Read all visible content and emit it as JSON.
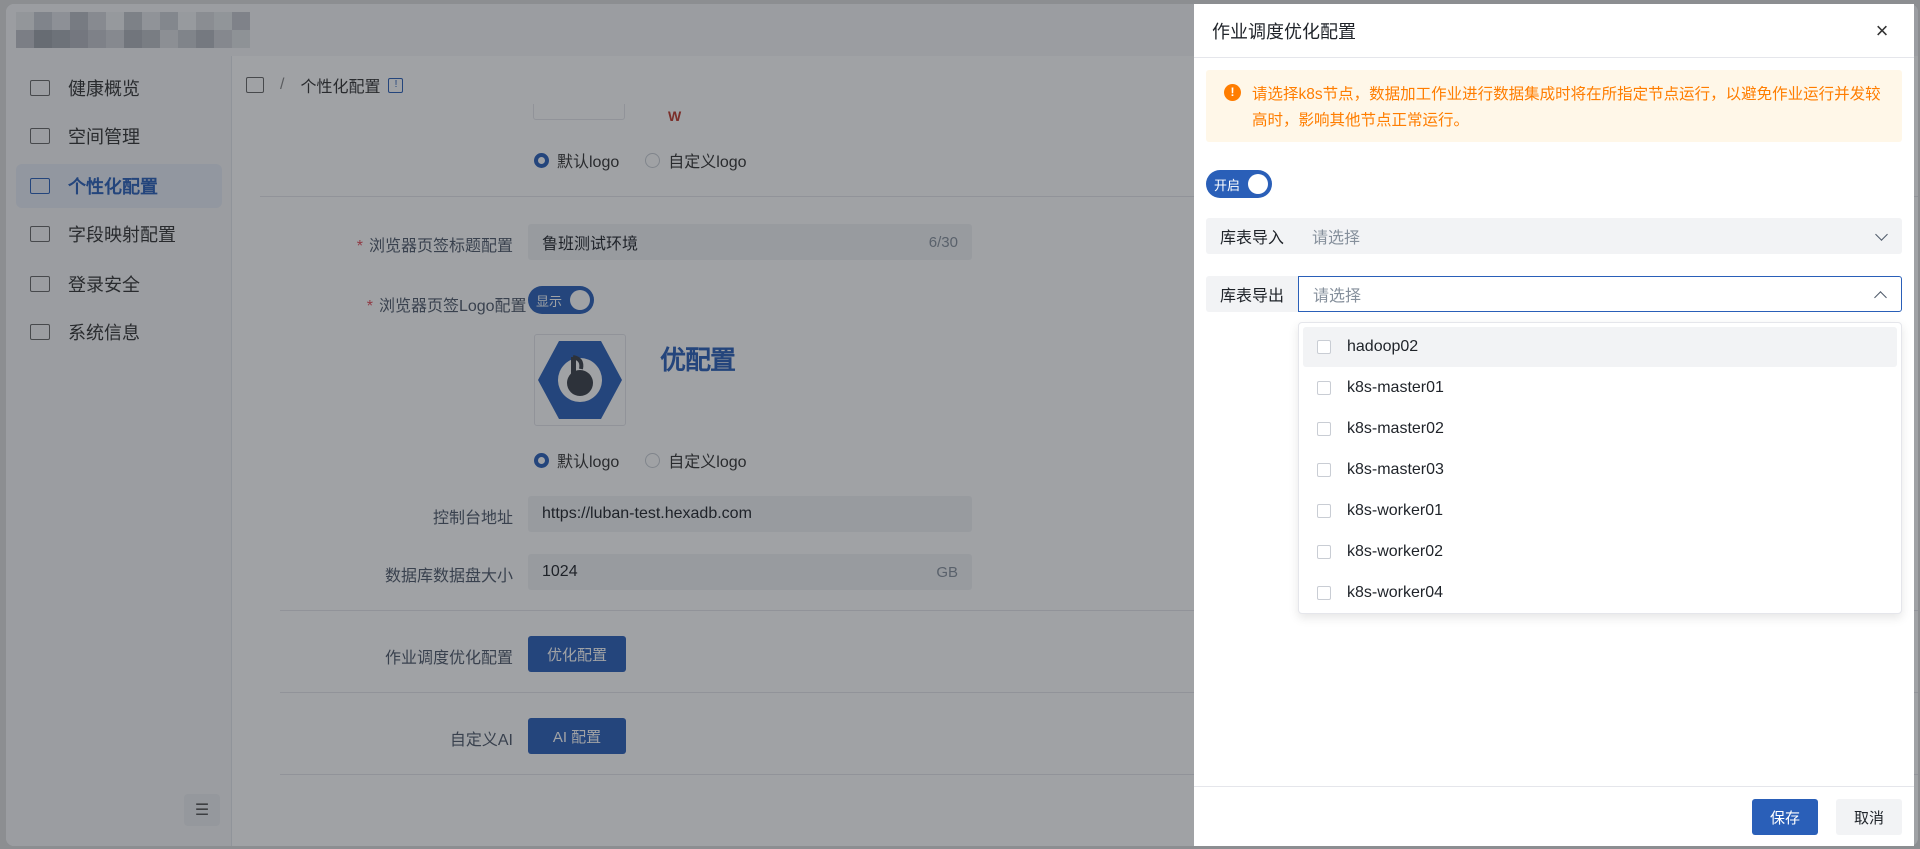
{
  "sidebar": {
    "items": [
      {
        "label": "健康概览",
        "icon": "pulse-monitor-icon"
      },
      {
        "label": "空间管理",
        "icon": "eye-monitor-icon"
      },
      {
        "label": "个性化配置",
        "icon": "monitor-icon",
        "active": true
      },
      {
        "label": "字段映射配置",
        "icon": "mapping-icon"
      },
      {
        "label": "登录安全",
        "icon": "lock-monitor-icon"
      },
      {
        "label": "系统信息",
        "icon": "sound-monitor-icon"
      }
    ]
  },
  "breadcrumb": {
    "separator": "/",
    "current": "个性化配置"
  },
  "form": {
    "top_radio": {
      "default_label": "默认logo",
      "custom_label": "自定义logo"
    },
    "tab_title": {
      "label": "浏览器页签标题配置",
      "value": "鲁班测试环境",
      "counter": "6/30"
    },
    "tab_logo": {
      "label": "浏览器页签Logo配置",
      "switch_label": "显示",
      "logo_text": "优配置"
    },
    "logo_radio": {
      "default_label": "默认logo",
      "custom_label": "自定义logo"
    },
    "console": {
      "label": "控制台地址",
      "value": "https://luban-test.hexadb.com"
    },
    "disk": {
      "label": "数据库数据盘大小",
      "value": "1024",
      "unit": "GB"
    },
    "schedule": {
      "label": "作业调度优化配置",
      "button": "优化配置"
    },
    "ai": {
      "label": "自定义AI",
      "button": "AI 配置"
    }
  },
  "drawer": {
    "title": "作业调度优化配置",
    "close": "×",
    "alert": "请选择k8s节点，数据加工作业进行数据集成时将在所指定节点运行，以避免作业运行并发较高时，影响其他节点正常运行。",
    "switch_label": "开启",
    "import": {
      "label": "库表导入",
      "placeholder": "请选择"
    },
    "export": {
      "label": "库表导出",
      "placeholder": "请选择"
    },
    "options": [
      "hadoop02",
      "k8s-master01",
      "k8s-master02",
      "k8s-master03",
      "k8s-worker01",
      "k8s-worker02",
      "k8s-worker04"
    ],
    "save": "保存",
    "cancel": "取消"
  },
  "colors": {
    "primary": "#2a5fb8",
    "warning": "#ff7d00",
    "warning_bg": "#fff7e8"
  }
}
